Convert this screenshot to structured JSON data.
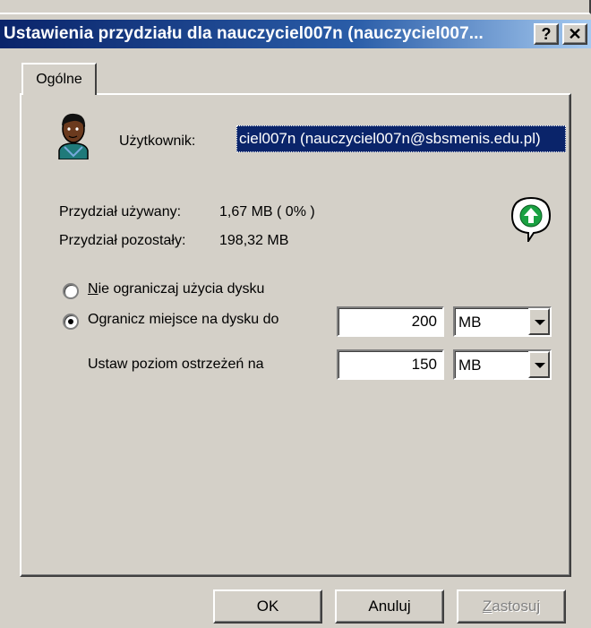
{
  "window": {
    "title": "Ustawienia przydziału dla nauczyciel007n (nauczyciel007...",
    "help_glyph": "?",
    "close_glyph": "✕"
  },
  "tabs": [
    {
      "label": "Ogólne",
      "selected": true
    }
  ],
  "user": {
    "label": "Użytkownik:",
    "value": "ciel007n (nauczyciel007n@sbsmenis.edu.pl)"
  },
  "quota": {
    "used_label": "Przydział używany:",
    "used_value": "1,67 MB ( 0% )",
    "remaining_label": "Przydział pozostały:",
    "remaining_value": "198,32 MB"
  },
  "options": {
    "no_limit": {
      "accesskey": "N",
      "rest": "ie ograniczaj użycia dysku",
      "selected": false
    },
    "limit": {
      "prefix": "O",
      "accesskey": "g",
      "rest": "ranicz miejsce na dysku do",
      "selected": true
    },
    "limit_value": "200",
    "limit_unit": "MB",
    "warning_label": "Ustaw poziom ostrzeżeń na",
    "warning_value": "150",
    "warning_unit": "MB"
  },
  "buttons": {
    "ok": "OK",
    "cancel": "Anuluj",
    "apply_accesskey": "Z",
    "apply_rest": "astosuj"
  },
  "colors": {
    "titlebar_start": "#0a246a",
    "titlebar_end": "#a6caf0",
    "dialog_face": "#d4d0c8",
    "selection": "#0a246a",
    "indicator_green": "#1aa142"
  },
  "icons": {
    "user_avatar": "user-icon",
    "status": "green-up-arrow-icon"
  }
}
